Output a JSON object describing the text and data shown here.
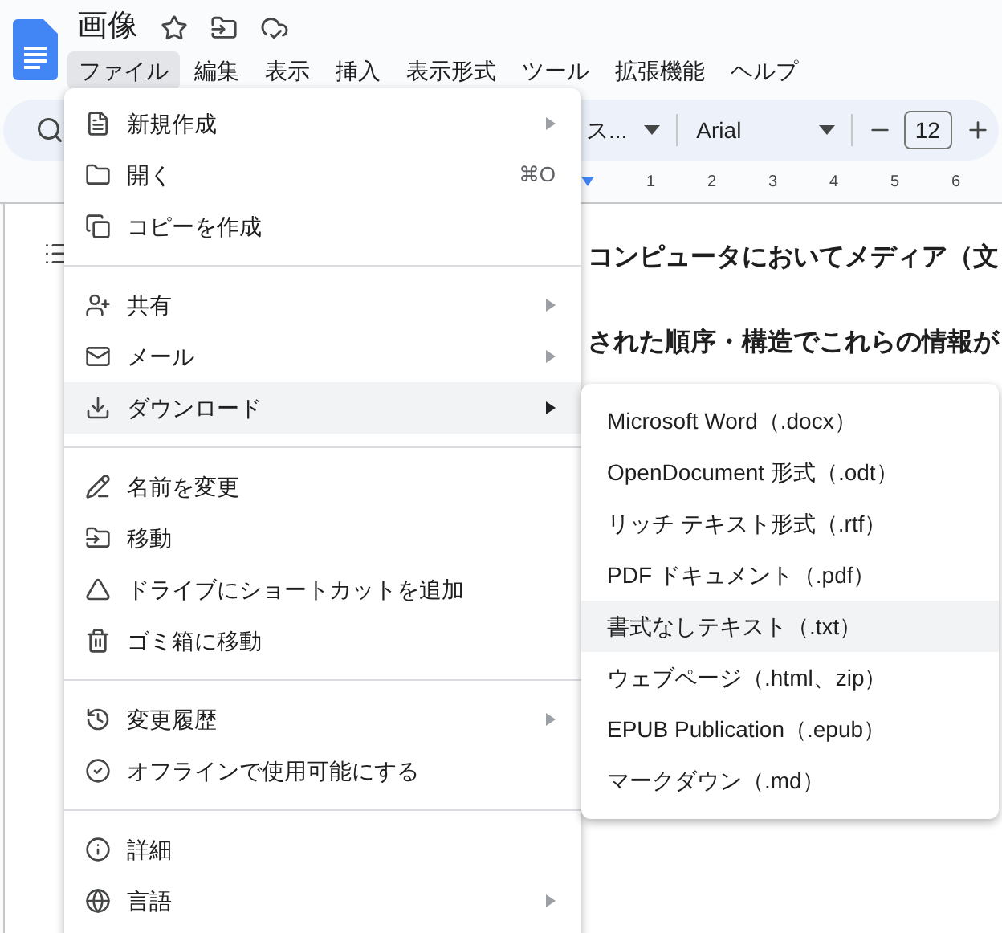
{
  "document": {
    "title": "画像"
  },
  "menu_bar": [
    {
      "label": "ファイル",
      "selected": true
    },
    {
      "label": "編集",
      "selected": false
    },
    {
      "label": "表示",
      "selected": false
    },
    {
      "label": "挿入",
      "selected": false
    },
    {
      "label": "表示形式",
      "selected": false
    },
    {
      "label": "ツール",
      "selected": false
    },
    {
      "label": "拡張機能",
      "selected": false
    },
    {
      "label": "ヘルプ",
      "selected": false
    }
  ],
  "toolbar": {
    "style": "ス...",
    "font": "Arial",
    "font_size": "12"
  },
  "ruler": [
    "1",
    "2",
    "3",
    "4",
    "5",
    "6"
  ],
  "body": [
    "コンピュータにおいてメディア（文",
    "された順序・構造でこれらの情報が"
  ],
  "file_menu": [
    {
      "kind": "item",
      "label": "新規作成",
      "has_submenu": true,
      "selected": false
    },
    {
      "kind": "item",
      "label": "開く",
      "shortcut": "⌘O",
      "has_submenu": false,
      "selected": false
    },
    {
      "kind": "item",
      "label": "コピーを作成",
      "has_submenu": false,
      "selected": false
    },
    {
      "kind": "divider"
    },
    {
      "kind": "item",
      "label": "共有",
      "has_submenu": true,
      "selected": false
    },
    {
      "kind": "item",
      "label": "メール",
      "has_submenu": true,
      "selected": false
    },
    {
      "kind": "item",
      "label": "ダウンロード",
      "has_submenu": true,
      "selected": true
    },
    {
      "kind": "divider"
    },
    {
      "kind": "item",
      "label": "名前を変更",
      "has_submenu": false,
      "selected": false
    },
    {
      "kind": "item",
      "label": "移動",
      "has_submenu": false,
      "selected": false
    },
    {
      "kind": "item",
      "label": "ドライブにショートカットを追加",
      "has_submenu": false,
      "selected": false
    },
    {
      "kind": "item",
      "label": "ゴミ箱に移動",
      "has_submenu": false,
      "selected": false
    },
    {
      "kind": "divider"
    },
    {
      "kind": "item",
      "label": "変更履歴",
      "has_submenu": true,
      "selected": false
    },
    {
      "kind": "item",
      "label": "オフラインで使用可能にする",
      "has_submenu": false,
      "selected": false
    },
    {
      "kind": "divider"
    },
    {
      "kind": "item",
      "label": "詳細",
      "has_submenu": false,
      "selected": false
    },
    {
      "kind": "item",
      "label": "言語",
      "has_submenu": true,
      "selected": false
    }
  ],
  "download_menu": [
    {
      "label": "Microsoft Word（.docx）",
      "selected": false
    },
    {
      "label": "OpenDocument 形式（.odt）",
      "selected": false
    },
    {
      "label": "リッチ テキスト形式（.rtf）",
      "selected": false
    },
    {
      "label": "PDF ドキュメント（.pdf）",
      "selected": false
    },
    {
      "label": "書式なしテキスト（.txt）",
      "selected": true
    },
    {
      "label": "ウェブページ（.html、zip）",
      "selected": false
    },
    {
      "label": "EPUB Publication（.epub）",
      "selected": false
    },
    {
      "label": "マークダウン（.md）",
      "selected": false
    }
  ]
}
